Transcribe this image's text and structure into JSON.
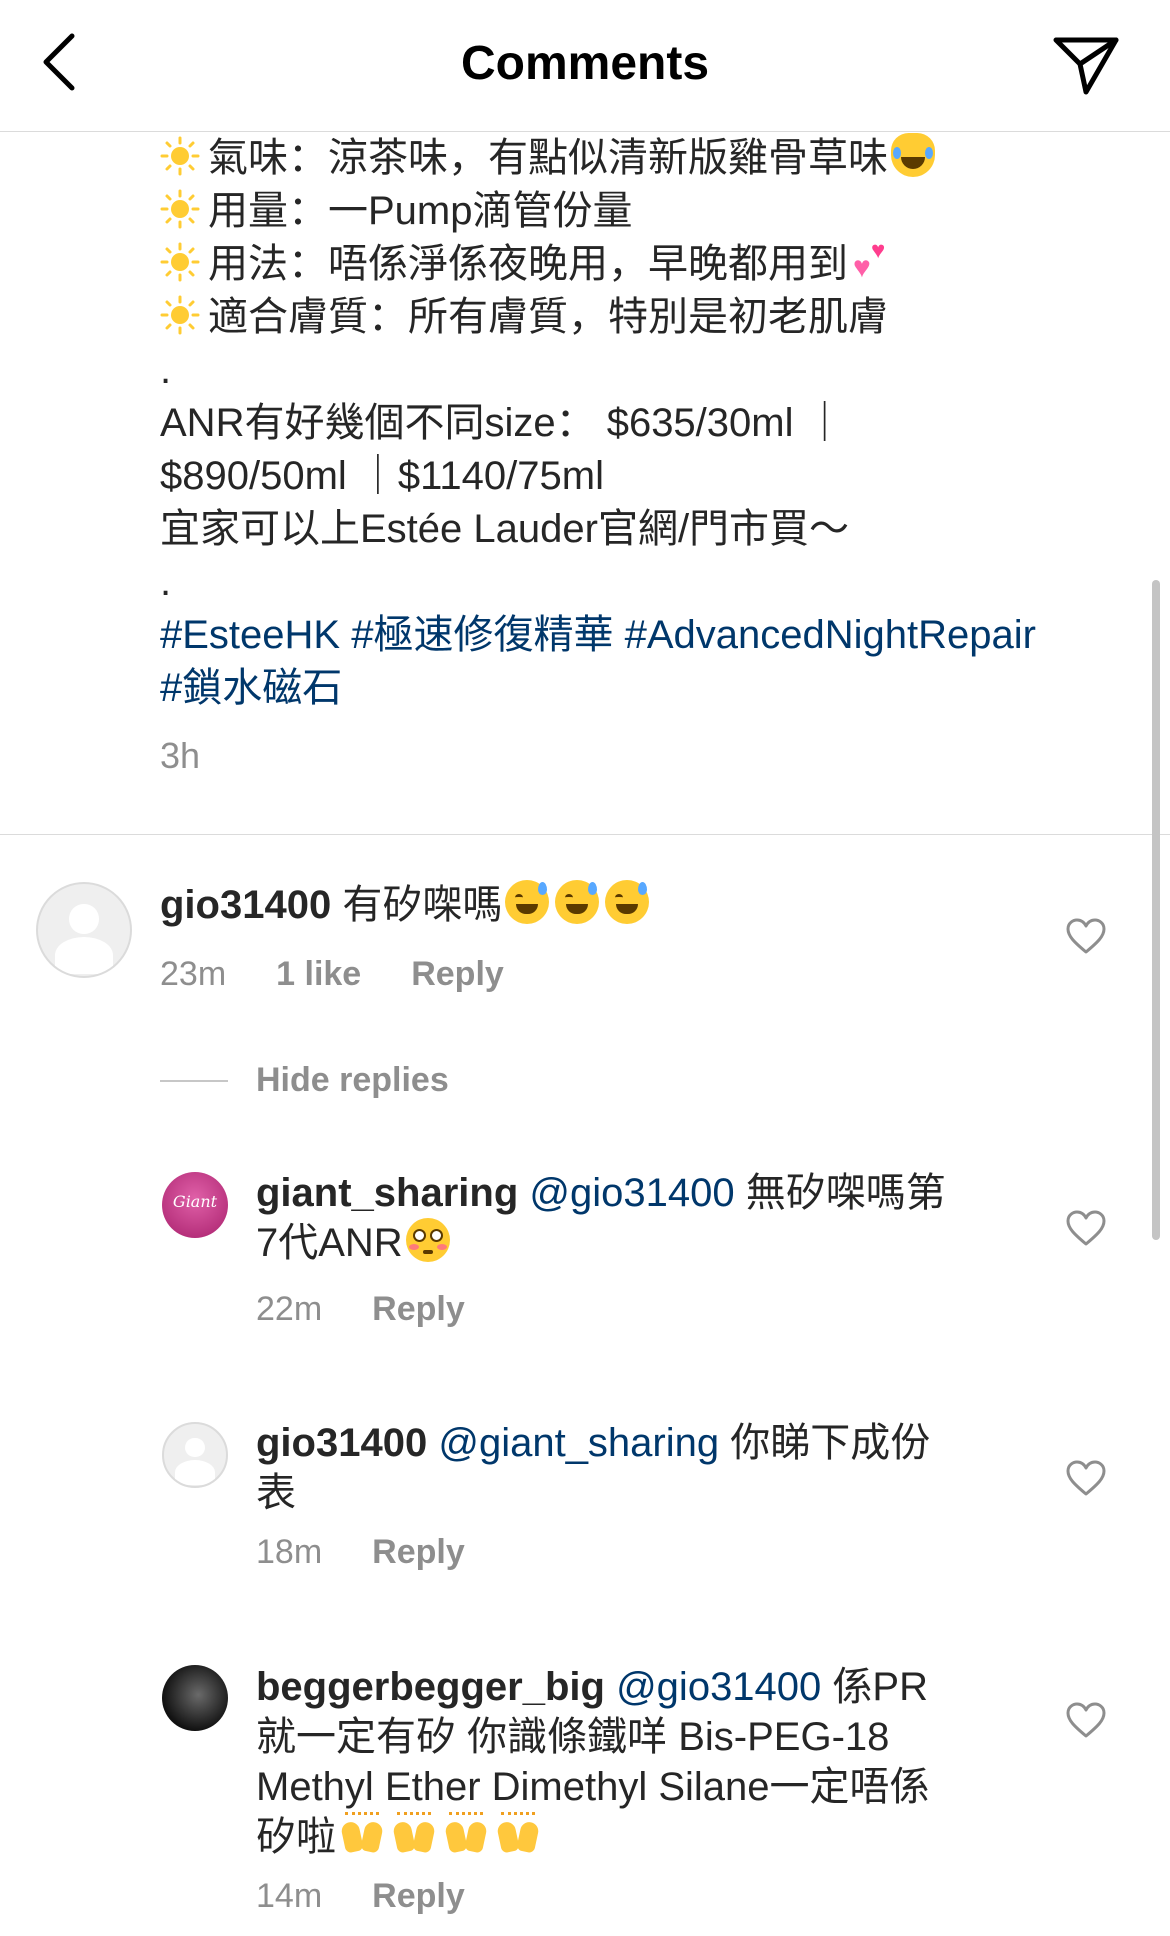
{
  "header": {
    "title": "Comments",
    "back_icon": "chevron-left-icon",
    "share_icon": "paper-plane-icon"
  },
  "caption": {
    "lines": [
      "氣味：涼茶味，有點似清新版雞骨草味",
      "用量：一Pump滴管份量",
      "用法：唔係淨係夜晚用，早晚都用到",
      "適合膚質：所有膚質，特別是初老肌膚",
      ".",
      "ANR有好幾個不同size： $635/30ml ｜",
      "$890/50ml ｜$1140/75ml",
      "宜家可以上Estée Lauder官網/門市買～",
      "."
    ],
    "hashtags_line1": "#EsteeHK #極速修復精華 #AdvancedNightRepair",
    "hashtags_line2": "#鎖水磁石",
    "time": "3h"
  },
  "comments": [
    {
      "username": "gio31400",
      "text": "有矽㗎嗎",
      "time": "23m",
      "likes": "1 like",
      "reply": "Reply"
    }
  ],
  "hide_replies": "Hide replies",
  "replies": [
    {
      "username": "giant_sharing",
      "mention": "@gio31400",
      "text_line1": "無矽㗎嗎第",
      "text_line2": "7代ANR",
      "avatar_label": "Giant",
      "time": "22m",
      "reply": "Reply"
    },
    {
      "username": "gio31400",
      "mention": "@giant_sharing",
      "text_line1": "你睇下成份",
      "text_line2": "表",
      "time": "18m",
      "reply": "Reply"
    },
    {
      "username": "beggerbegger_big",
      "mention": "@gio31400",
      "text_line1": "係PR",
      "text_line2": "就一定有矽 你識條鐵咩 Bis-PEG-18",
      "text_line3": "Methyl Ether Dimethyl Silane一定唔係",
      "text_line4": "矽啦",
      "time": "14m",
      "reply": "Reply"
    }
  ]
}
